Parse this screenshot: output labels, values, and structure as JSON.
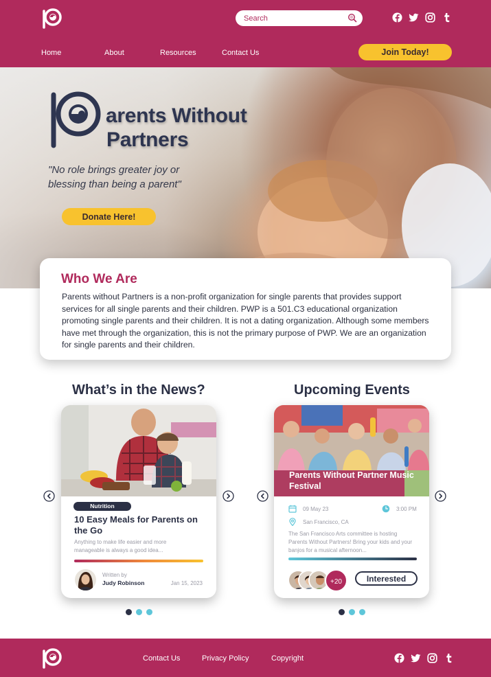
{
  "header": {
    "search_placeholder": "Search",
    "nav": [
      "Home",
      "About",
      "Resources",
      "Contact Us"
    ],
    "join_label": "Join Today!",
    "social_icons": [
      "facebook-icon",
      "twitter-icon",
      "instagram-icon",
      "tumblr-icon"
    ]
  },
  "hero": {
    "title_line1": "arents Without",
    "title_line2": "Partners",
    "quote_line1": "\"No role brings greater joy or",
    "quote_line2": "blessing than being a parent\"",
    "donate_label": "Donate Here!"
  },
  "who": {
    "title": "Who We Are",
    "body": "Parents without Partners is a non-profit organization for single parents that provides support services for all single parents and their children. PWP is a 501.C3 educational organization promoting single parents and their children. It is not a dating organization. Although some members have met through the organization, this is not the primary purpose of PWP. We are an organization for single parents and their children."
  },
  "news": {
    "section_title": "What’s in the News?",
    "tag": "Nutrition",
    "title": "10 Easy Meals for Parents on the Go",
    "excerpt": "Anything to make life easier and more manageable is always a good idea...",
    "written_by": "Written by",
    "author": "Judy Robinson",
    "date": "Jan 15, 2023"
  },
  "events": {
    "section_title": "Upcoming Events",
    "title": "Parents Without Partner Music Festival",
    "date": "09 May 23",
    "time": "3:00 PM",
    "location": "San Francisco, CA",
    "description": "The San Francisco Arts committee is hosting Parents Without Partners! Bring your kids and your banjos for a musical afternoon...",
    "attendee_extra": "+20",
    "interested_label": "Interested"
  },
  "footer": {
    "links": [
      "Contact Us",
      "Privacy Policy",
      "Copyright"
    ]
  },
  "colors": {
    "brand": "#b02a5c",
    "accent": "#f8c22e",
    "navy": "#2b3045",
    "teal": "#5ec6d9"
  }
}
